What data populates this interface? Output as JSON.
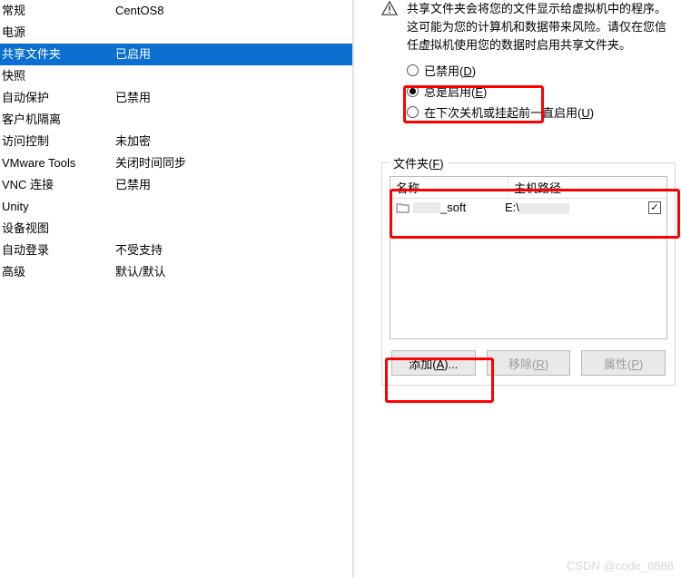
{
  "left": {
    "items": [
      {
        "label": "常规",
        "value": "CentOS8"
      },
      {
        "label": "电源",
        "value": ""
      },
      {
        "label": "共享文件夹",
        "value": "已启用",
        "selected": true
      },
      {
        "label": "快照",
        "value": ""
      },
      {
        "label": "自动保护",
        "value": "已禁用"
      },
      {
        "label": "客户机隔离",
        "value": ""
      },
      {
        "label": "访问控制",
        "value": "未加密"
      },
      {
        "label": "VMware Tools",
        "value": "关闭时间同步"
      },
      {
        "label": "VNC 连接",
        "value": "已禁用"
      },
      {
        "label": "Unity",
        "value": ""
      },
      {
        "label": "设备视图",
        "value": ""
      },
      {
        "label": "自动登录",
        "value": "不受支持"
      },
      {
        "label": "高级",
        "value": "默认/默认"
      }
    ]
  },
  "right": {
    "warning": "共享文件夹会将您的文件显示给虚拟机中的程序。这可能为您的计算机和数据带来风险。请仅在您信任虚拟机使用您的数据时启用共享文件夹。",
    "radios": {
      "disabled_pre": "已禁用(",
      "disabled_u": "D",
      "disabled_post": ")",
      "always_pre": "总是启用(",
      "always_u": "E",
      "always_post": ")",
      "next_pre": "在下次关机或挂起前一直启用(",
      "next_u": "U",
      "next_post": ")"
    },
    "fieldset": {
      "legend_pre": "文件夹(",
      "legend_u": "F",
      "legend_post": ")",
      "col_name": "名称",
      "col_path": "主机路径",
      "entry": {
        "name_suffix": "_soft",
        "path_prefix": "E:\\"
      }
    },
    "buttons": {
      "add_pre": "添加(",
      "add_u": "A",
      "add_post": ")...",
      "remove_pre": "移除(",
      "remove_u": "R",
      "remove_post": ")",
      "props_pre": "属性(",
      "props_u": "P",
      "props_post": ")"
    }
  },
  "watermark": "CSDN @code_8888"
}
